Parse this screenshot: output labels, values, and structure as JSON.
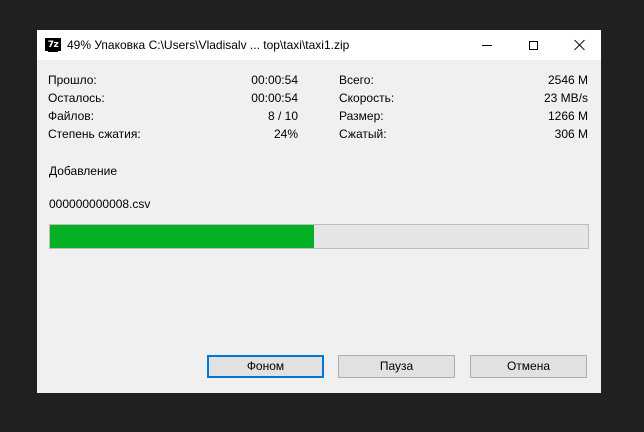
{
  "window": {
    "app_icon_text": "7z",
    "title": "49% Упаковка C:\\Users\\Vladisalv ... top\\taxi\\taxi1.zip"
  },
  "stats_left": [
    {
      "label": "Прошло:",
      "value": "00:00:54"
    },
    {
      "label": "Осталось:",
      "value": "00:00:54"
    },
    {
      "label": "Файлов:",
      "value": "8 / 10"
    },
    {
      "label": "Степень сжатия:",
      "value": "24%"
    }
  ],
  "stats_right": [
    {
      "label": "Всего:",
      "value": "2546 M"
    },
    {
      "label": "Скорость:",
      "value": "23 MB/s"
    },
    {
      "label": "Размер:",
      "value": "1266 M"
    },
    {
      "label": "Сжатый:",
      "value": "306 M"
    }
  ],
  "status": "Добавление",
  "current_file": "000000000008.csv",
  "progress": {
    "percent": 49,
    "color": "#06b025"
  },
  "buttons": {
    "background": "Фоном",
    "pause": "Пауза",
    "cancel": "Отмена"
  },
  "accent_color": "#0078d7",
  "icons": [
    "7zip-app-icon",
    "minimize-icon",
    "maximize-icon",
    "close-icon"
  ]
}
